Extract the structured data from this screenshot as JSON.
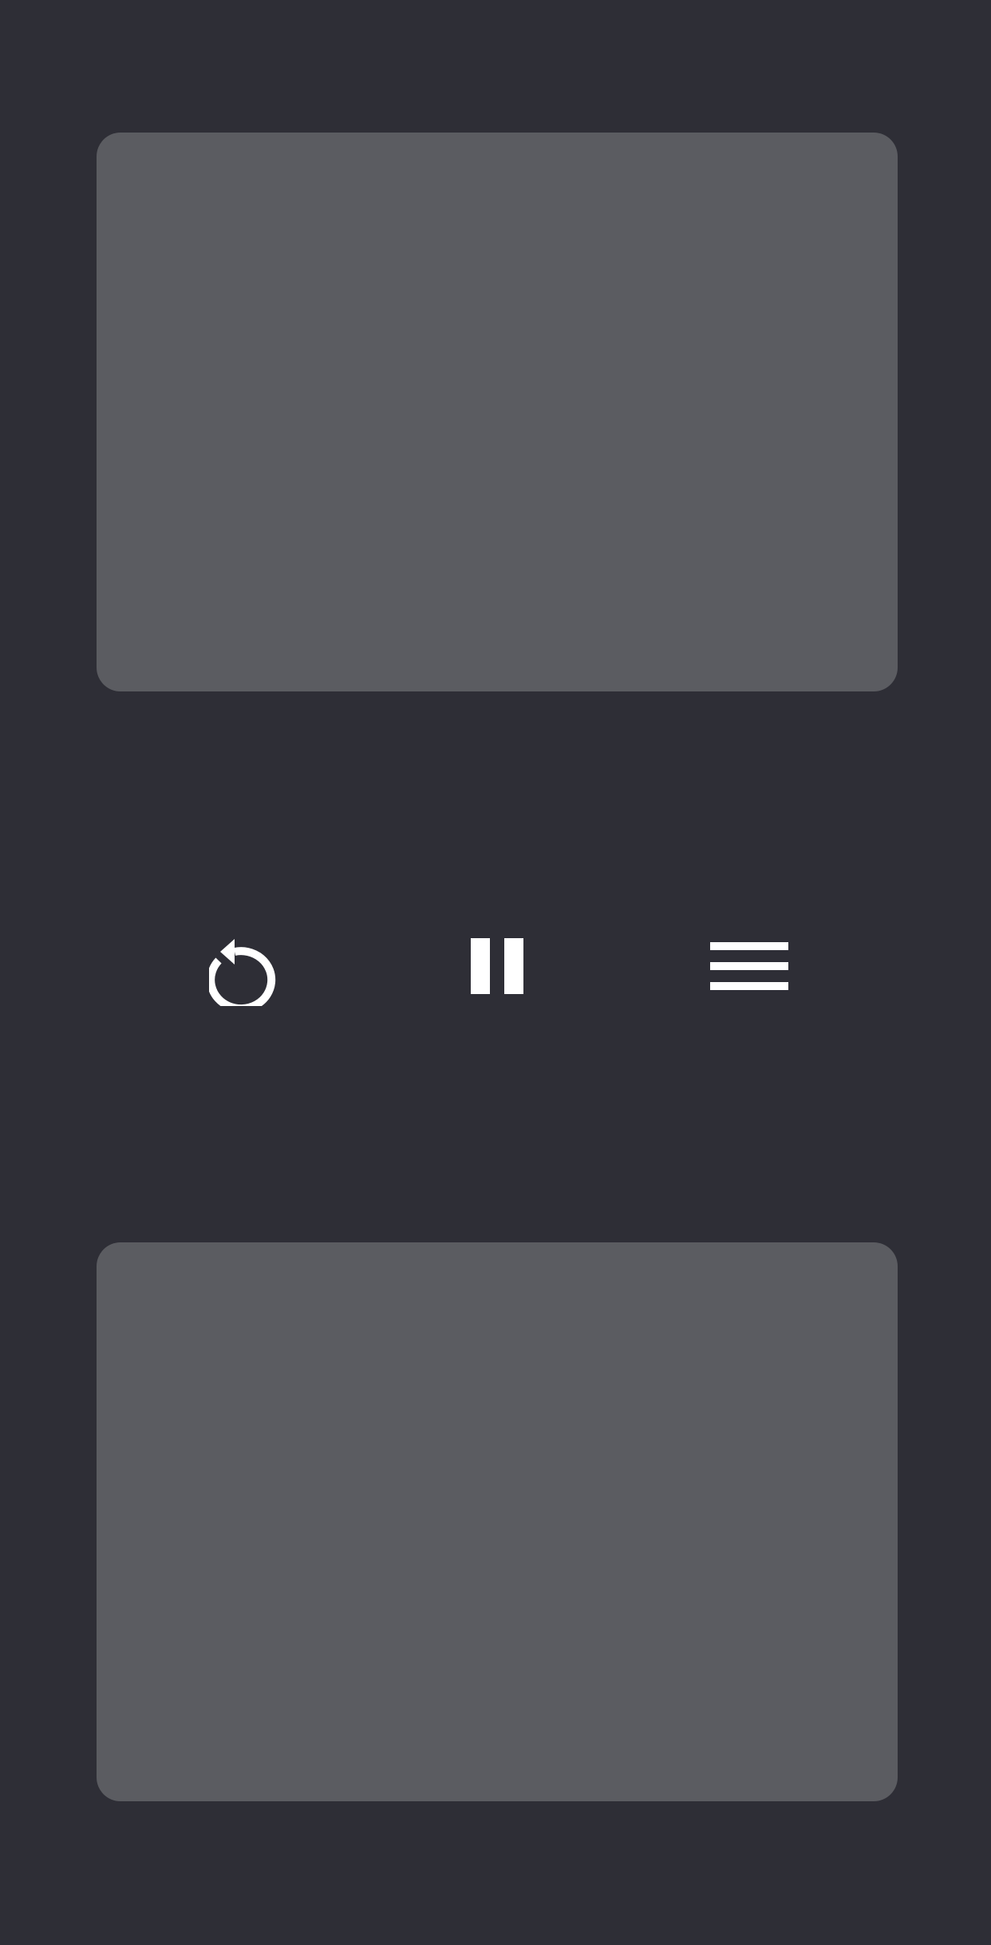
{
  "panels": {
    "top": {
      "color": "#5b5c61"
    },
    "bottom": {
      "color": "#5b5c61"
    }
  },
  "controls": [
    {
      "id": "restart",
      "icon": "restart-icon"
    },
    {
      "id": "pause",
      "icon": "pause-icon"
    },
    {
      "id": "menu",
      "icon": "menu-icon"
    }
  ],
  "colors": {
    "background": "#2e2e36",
    "panel": "#5b5c61",
    "icon": "#ffffff"
  }
}
